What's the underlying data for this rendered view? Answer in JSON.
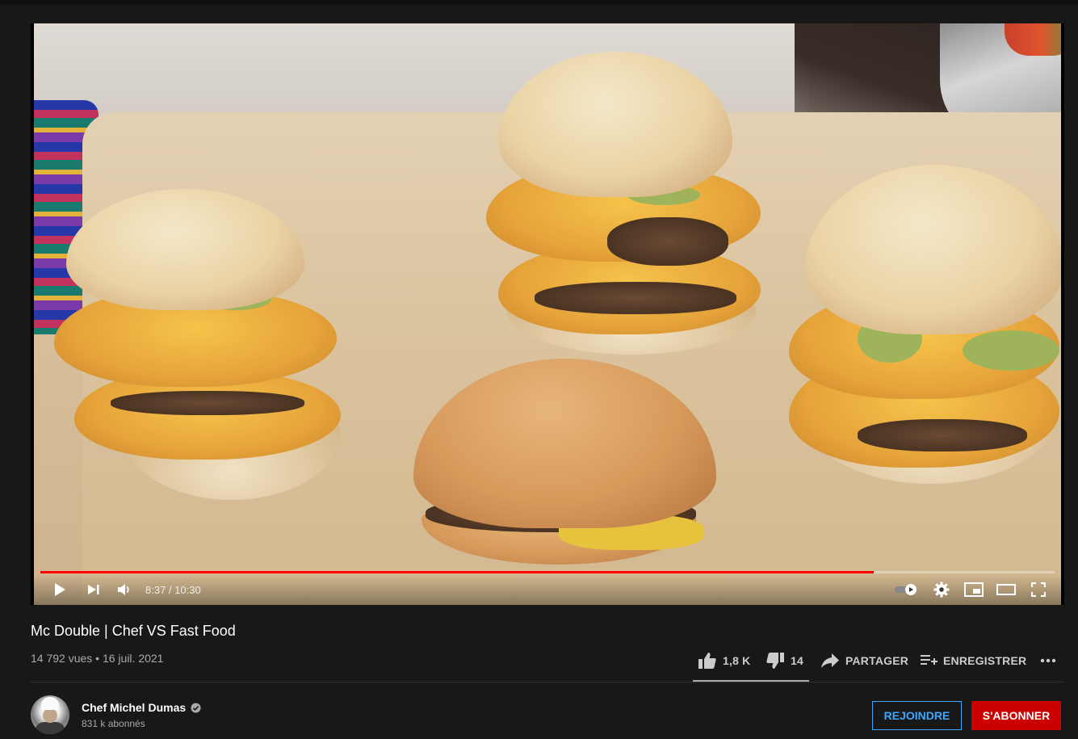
{
  "player": {
    "time_display": "8:37 / 10:30",
    "progress_fraction": 0.822,
    "accent_color": "#ff0000",
    "controls": [
      "play-icon",
      "next-icon",
      "volume-icon",
      "autoplay-toggle-icon",
      "settings-icon",
      "miniplayer-icon",
      "theater-icon",
      "fullscreen-icon"
    ]
  },
  "video": {
    "title": "Mc Double | Chef VS Fast Food",
    "meta": "14 792 vues • 16 juil. 2021"
  },
  "actions": {
    "like_count": "1,8 K",
    "dislike_count": "14",
    "share_label": "PARTAGER",
    "save_label": "ENREGISTRER",
    "more_icon": "more-icon"
  },
  "channel": {
    "name": "Chef Michel Dumas",
    "subscribers": "831 k abonnés",
    "verified_icon": "verified-icon",
    "join_label": "REJOINDRE",
    "subscribe_label": "S'ABONNER",
    "join_color": "#3ea6ff",
    "subscribe_color": "#cc0000"
  }
}
